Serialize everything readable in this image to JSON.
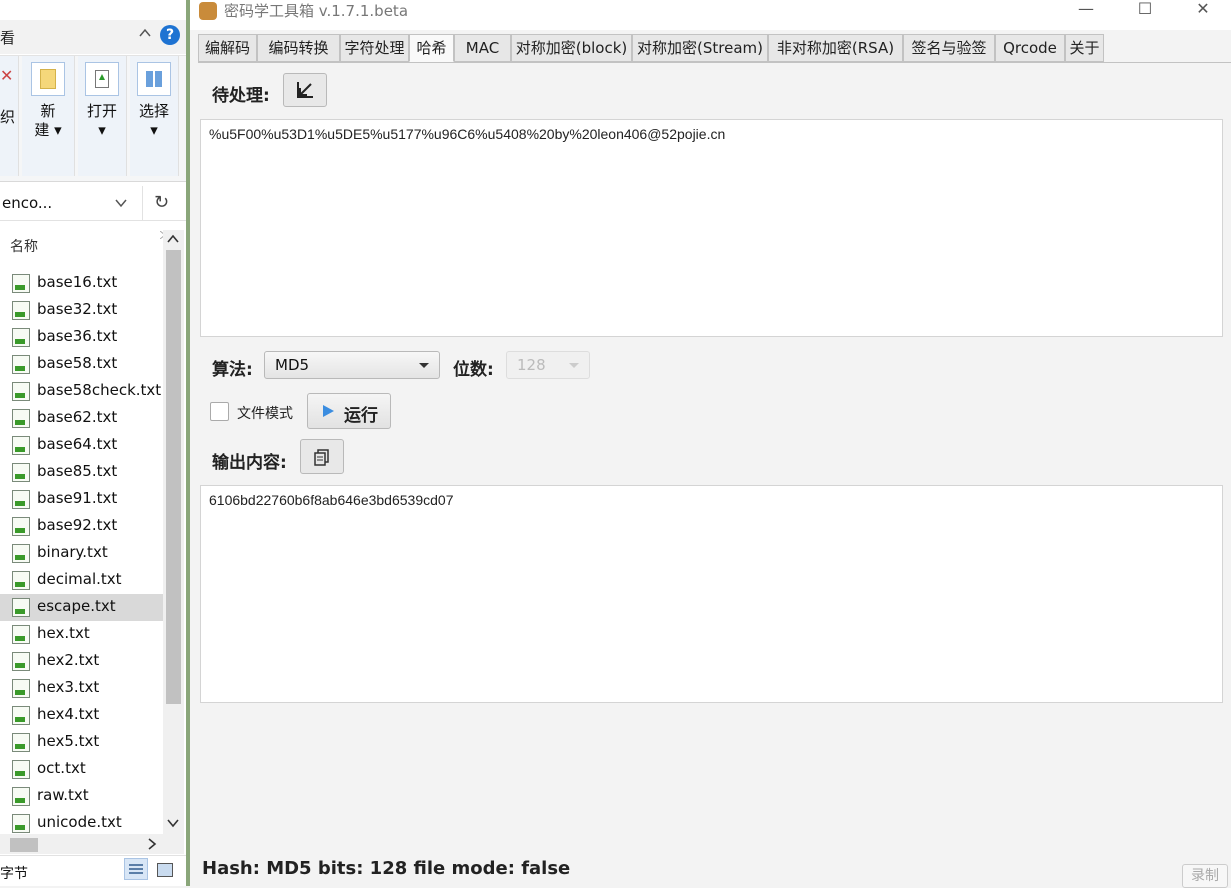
{
  "explorer": {
    "title": "看",
    "help": "?",
    "ribbon": {
      "new_top": "新",
      "new_bottom": "建",
      "open": "打开",
      "select": "选择",
      "organize": "织"
    },
    "address": "enco...",
    "column_name": "名称",
    "files": [
      "base16.txt",
      "base32.txt",
      "base36.txt",
      "base58.txt",
      "base58check.txt",
      "base62.txt",
      "base64.txt",
      "base85.txt",
      "base91.txt",
      "base92.txt",
      "binary.txt",
      "decimal.txt",
      "escape.txt",
      "hex.txt",
      "hex2.txt",
      "hex3.txt",
      "hex4.txt",
      "hex5.txt",
      "oct.txt",
      "raw.txt",
      "unicode.txt"
    ],
    "selected_file": "escape.txt",
    "status_text": "字节"
  },
  "app": {
    "title": "密码学工具箱 v.1.7.1.beta",
    "tabs": [
      "编解码",
      "编码转换",
      "字符处理",
      "哈希",
      "MAC",
      "对称加密(block)",
      "对称加密(Stream)",
      "非对称加密(RSA)",
      "签名与验签",
      "Qrcode",
      "关于"
    ],
    "active_tab": "哈希",
    "input_label": "待处理:",
    "input_text": "%u5F00%u53D1%u5DE5%u5177%u96C6%u5408%20by%20leon406@52pojie.cn",
    "algorithm_label": "算法:",
    "algorithm_value": "MD5",
    "bits_label": "位数:",
    "bits_value": "128",
    "file_mode_label": "文件模式",
    "file_mode_checked": false,
    "run_label": "运行",
    "output_label": "输出内容:",
    "output_text": "6106bd22760b6f8ab646e3bd6539cd07",
    "status": "Hash: MD5 bits: 128  file mode: false",
    "record_label": "录制"
  },
  "colors": {
    "accent": "#3b8de0",
    "help": "#1e73d2",
    "selection": "#d9d9d9"
  }
}
